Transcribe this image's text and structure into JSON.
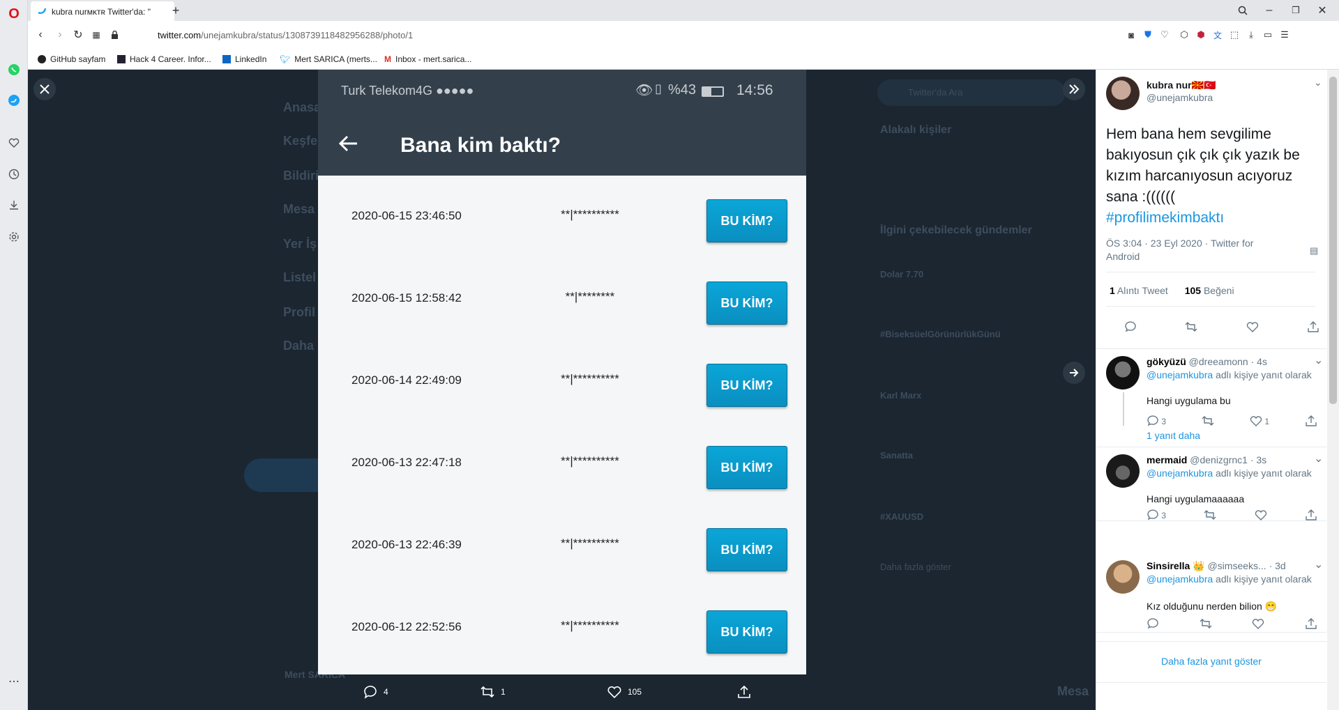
{
  "browser": {
    "tab_title": "kubra nurᴍᴋᴛʀ Twitter'da: \"",
    "new_tab": "+",
    "url_domain": "twitter.com",
    "url_path": "/unejamkubra/status/1308739118482956288/photo/1",
    "bookmarks": [
      "GitHub sayfam",
      "Hack 4 Career. Infor...",
      "LinkedIn",
      "Mert SARICA (merts...",
      "Inbox - mert.sarica..."
    ]
  },
  "photo": {
    "carrier": "Turk Telekom4G ●●●●●",
    "status_right": "%43",
    "time": "14:56",
    "header_title": "Bana kim baktı?",
    "rows": [
      {
        "date": "2020-06-15 23:46:50",
        "mask": "**|**********",
        "button": "BU KİM?"
      },
      {
        "date": "2020-06-15 12:58:42",
        "mask": "**|********",
        "button": "BU KİM?"
      },
      {
        "date": "2020-06-14 22:49:09",
        "mask": "**|**********",
        "button": "BU KİM?"
      },
      {
        "date": "2020-06-13 22:47:18",
        "mask": "**|**********",
        "button": "BU KİM?"
      },
      {
        "date": "2020-06-13 22:46:39",
        "mask": "**|**********",
        "button": "BU KİM?"
      },
      {
        "date": "2020-06-12 22:52:56",
        "mask": "**|**********",
        "button": "BU KİM?"
      }
    ],
    "actions": {
      "replies": "4",
      "retweets": "1",
      "likes": "105"
    }
  },
  "background": {
    "nav": [
      "Anasa",
      "Keşfe",
      "Bildiri",
      "Mesa",
      "Yer İş",
      "Listel",
      "Profil",
      "Daha"
    ],
    "search_placeholder": "Twitter'da Ara",
    "related_title": "Alakalı kişiler",
    "trends_title": "İlgini çekebilecek gündemler",
    "trends": [
      "Dolar 7.70",
      "#BiseksüelGörünürlükGünü",
      "Karl Marx",
      "Sanatta",
      "#XAUUSD"
    ],
    "show_more": "Daha fazla göster",
    "user_name": "Mert SARICA",
    "messages": "Mesa"
  },
  "panel": {
    "author_name": "kubra nur🇲🇰🇹🇷",
    "author_handle": "@unejamkubra",
    "tweet_text": "Hem bana hem sevgilime bakıyosun çık çık çık yazık be kızım harcanıyosun acıyoruz sana :((((((",
    "hashtag": "#profilimekimbaktı",
    "meta": "ÖS 3:04 · 23 Eyl 2020 · Twitter for Android",
    "quote_count": "1",
    "quote_label": "Alıntı Tweet",
    "like_count": "105",
    "like_label": "Beğeni",
    "replies": [
      {
        "name": "gökyüzü",
        "handle": "@dreeamonn",
        "time": "· 4s",
        "reply_to": "@unejamkubra",
        "reply_suffix": "adlı kişiye yanıt olarak",
        "text": "Hangi uygulama bu",
        "replies": "3",
        "likes": "1"
      },
      {
        "name": "mermaid",
        "handle": "@denizgrnc1",
        "time": "· 3s",
        "reply_to": "@unejamkubra",
        "reply_suffix": "adlı kişiye yanıt olarak",
        "text": "Hangi uygulamaaaaaa",
        "replies": "3",
        "likes": ""
      },
      {
        "name": "Sinsirella 👑",
        "handle": "@simseeks...",
        "time": "· 3d",
        "reply_to": "@unejamkubra",
        "reply_suffix": "adlı kişiye yanıt olarak",
        "text": "Kız olduğunu nerden bilion 😁",
        "replies": "",
        "likes": ""
      }
    ],
    "more_replies_thread": "1 yanıt daha",
    "show_more_replies": "Daha fazla yanıt göster"
  },
  "colors": {
    "accent": "#1b95e0",
    "button": "#0a9ccf",
    "overlay": "#1b2631"
  }
}
